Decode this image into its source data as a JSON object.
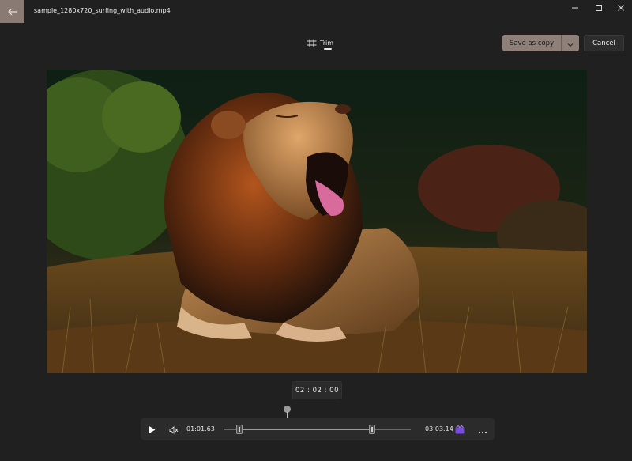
{
  "window": {
    "title": "sample_1280x720_surfing_with_audio.mp4",
    "back_icon": "arrow-left-icon",
    "controls": [
      "minimize-icon",
      "maximize-icon",
      "close-icon"
    ]
  },
  "toolbar": {
    "trim_label": "Trim",
    "trim_icon": "trim-icon",
    "save_label": "Save as copy",
    "cancel_label": "Cancel",
    "accent": "#8f7f79"
  },
  "video": {
    "description_icon": "video-frame"
  },
  "playback": {
    "current_time_bubble": "02 : 02 : 00",
    "trim_start": "01:01.63",
    "trim_end": "03:03.14",
    "trim_start_fraction": 0.08,
    "trim_end_fraction": 0.8,
    "playhead_fraction": 0.34
  }
}
